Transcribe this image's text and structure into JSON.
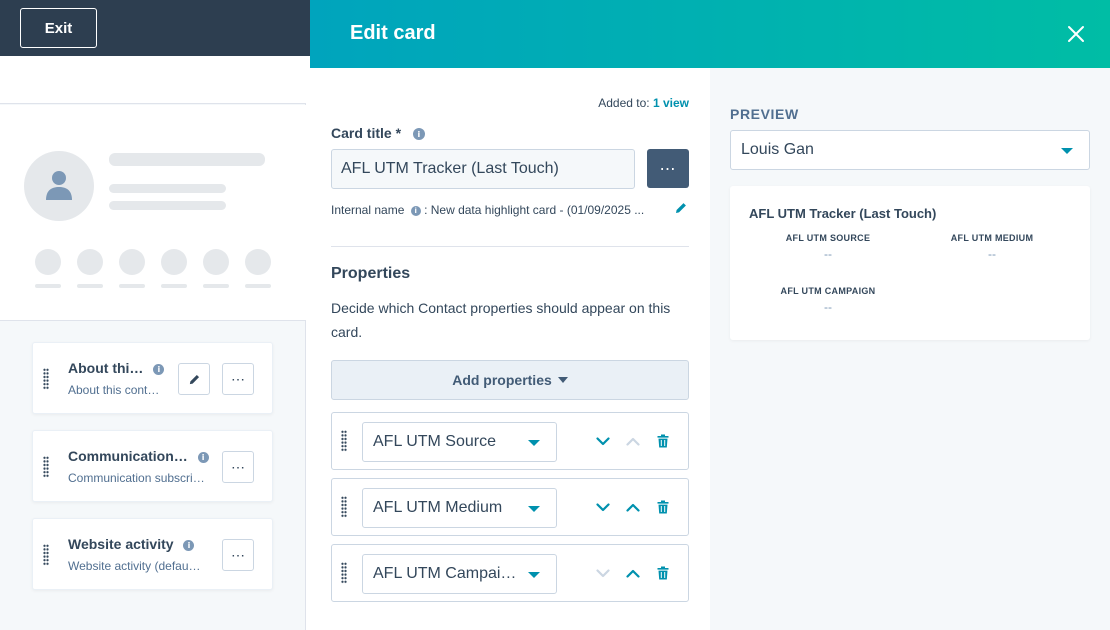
{
  "app": {
    "exit_label": "Exit"
  },
  "sidebar": {
    "cards": [
      {
        "title": "About thi…",
        "subtitle": "About this cont…"
      },
      {
        "title": "Communication…",
        "subtitle": "Communication subscri…"
      },
      {
        "title": "Website activity",
        "subtitle": "Website activity (defau…"
      }
    ]
  },
  "panel": {
    "title": "Edit card",
    "added_to_prefix": "Added to:",
    "added_to_link": "1 view",
    "card_title_label": "Card title *",
    "card_title_value": "AFL UTM Tracker (Last Touch)",
    "internal_name_label": "Internal name",
    "internal_name_value": ": New data highlight card - (01/09/2025 ...",
    "properties_title": "Properties",
    "properties_desc": "Decide which Contact properties should appear on this card.",
    "add_properties_label": "Add properties",
    "property_rows": [
      {
        "value": "AFL UTM Source"
      },
      {
        "value": "AFL UTM Medium"
      },
      {
        "value": "AFL UTM Campai…"
      }
    ]
  },
  "preview": {
    "label": "PREVIEW",
    "selected_record": "Louis Gan",
    "card_title": "AFL UTM Tracker (Last Touch)",
    "properties": [
      {
        "label": "AFL UTM SOURCE",
        "value": "--"
      },
      {
        "label": "AFL UTM MEDIUM",
        "value": "--"
      },
      {
        "label": "AFL UTM CAMPAIGN",
        "value": "--"
      }
    ]
  },
  "colors": {
    "header_gradient_start": "#00a4bd",
    "header_gradient_end": "#00bda5",
    "link": "#0091ae",
    "top_bar": "#2d3e50"
  }
}
